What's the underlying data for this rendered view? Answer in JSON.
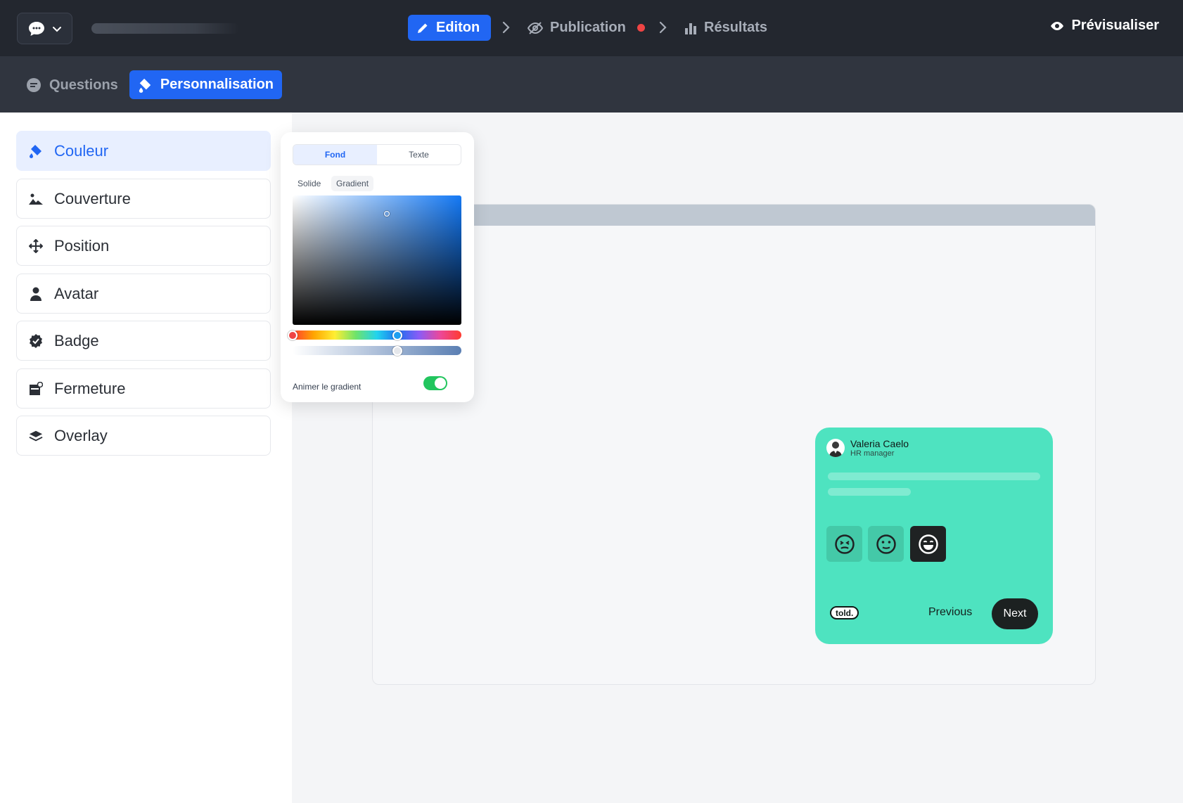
{
  "topbar": {
    "steps": [
      {
        "label": "Editon",
        "icon": "pencil-icon",
        "active": true
      },
      {
        "label": "Publication",
        "icon": "eye-off-icon",
        "status_color": "#ef4444"
      },
      {
        "label": "Résultats",
        "icon": "bar-chart-icon"
      }
    ],
    "preview_label": "Prévisualiser"
  },
  "subnav": {
    "questions_label": "Questions",
    "personnalisation_label": "Personnalisation"
  },
  "sidebar": {
    "items": [
      {
        "label": "Couleur",
        "icon": "paint-bucket-icon",
        "active": true
      },
      {
        "label": "Couverture",
        "icon": "image-icon"
      },
      {
        "label": "Position",
        "icon": "move-icon"
      },
      {
        "label": "Avatar",
        "icon": "user-icon"
      },
      {
        "label": "Badge",
        "icon": "badge-check-icon"
      },
      {
        "label": "Fermeture",
        "icon": "close-window-icon"
      },
      {
        "label": "Overlay",
        "icon": "layers-icon"
      }
    ]
  },
  "color_picker": {
    "tabs": [
      "Fond",
      "Texte"
    ],
    "active_tab": "Fond",
    "modes": [
      "Solide",
      "Gradient"
    ],
    "active_mode": "Gradient",
    "hue_level": 0.62,
    "alpha_level": 0.62,
    "saturation": 0.56,
    "brightness": 0.86,
    "animate_label": "Animer le gradient",
    "animate_on": true
  },
  "widget": {
    "name": "Valeria Caelo",
    "role": "HR manager",
    "brand": "told.",
    "previous_label": "Previous",
    "next_label": "Next",
    "background_color": "#4ee3c0",
    "emojis": [
      "angry-face-icon",
      "neutral-face-icon",
      "happy-face-icon"
    ],
    "selected_emoji": 2
  },
  "colors": {
    "accent": "#2166f3",
    "topbar": "#23272f",
    "subbar": "#30353f"
  }
}
